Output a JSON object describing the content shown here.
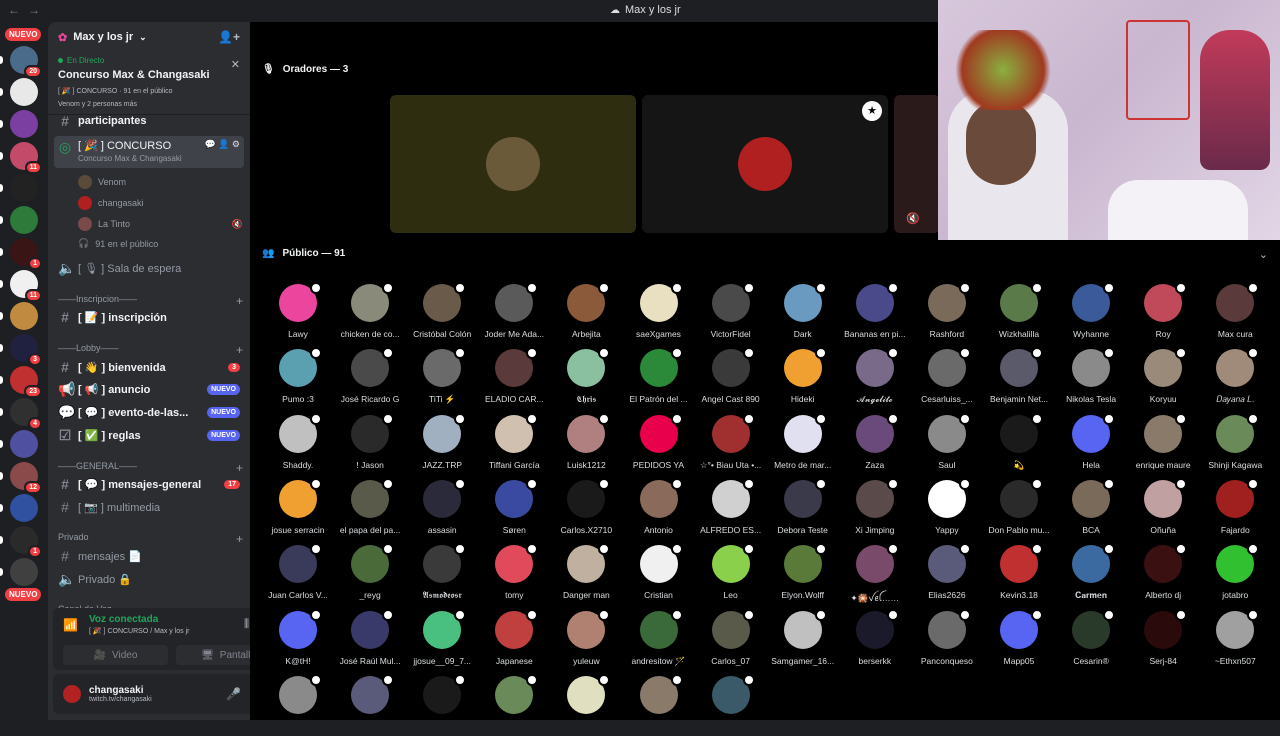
{
  "titlebar": {
    "title": "Max y los jr"
  },
  "server_rail": {
    "nuevo_top": "NUEVO",
    "nuevo_bottom": "NUEVO",
    "servers": [
      {
        "badge": "20",
        "color": "#4a6b8a"
      },
      {
        "badge": "",
        "color": "#e8e8e8"
      },
      {
        "badge": "",
        "color": "#7a3fa0"
      },
      {
        "badge": "11",
        "color": "#c44a6a"
      },
      {
        "badge": "",
        "color": "#222222"
      },
      {
        "badge": "",
        "color": "#2d7a3a"
      },
      {
        "badge": "1",
        "color": "#3a1515"
      },
      {
        "badge": "11",
        "color": "#f0f0f0"
      },
      {
        "badge": "",
        "color": "#c08a40"
      },
      {
        "badge": "3",
        "color": "#202040"
      },
      {
        "badge": "23",
        "color": "#c03030"
      },
      {
        "badge": "4",
        "color": "#303030"
      },
      {
        "badge": "",
        "color": "#5050a0"
      },
      {
        "badge": "12",
        "color": "#8a4a4a"
      },
      {
        "badge": "",
        "color": "#3050a0"
      },
      {
        "badge": "1",
        "color": "#2a2a2a"
      },
      {
        "badge": "",
        "color": "#404040"
      }
    ]
  },
  "server": {
    "name": "Max y los jr"
  },
  "event": {
    "live_label": "En Directo",
    "title": "Concurso Max & Changasaki",
    "meta": "[ 🎉 ] CONCURSO · 91 en el público",
    "attendees": "Venom y 2 personas más"
  },
  "channels": {
    "partial_top": "participantes",
    "concurso": {
      "name": "[ 🎉 ] CONCURSO",
      "sub": "Concurso Max & Changasaki"
    },
    "voice_users": [
      "Venom",
      "changasaki",
      "La Tinto"
    ],
    "audience": "91 en el público",
    "waiting": "[ 🎙 ] Sala de espera",
    "cat_inscripcion": "——Inscripcion——",
    "inscripcion": "[ 📝 ] inscripción",
    "cat_lobby": "——Lobby——",
    "bienvenida": "[ 👋 ] bienvenida",
    "bienvenida_count": "3",
    "anuncio": "[ 📢 ] anuncio",
    "evento": "[ 💬 ] evento-de-las...",
    "reglas": "[ ✅ ] reglas",
    "nuevo_tag": "NUEVO",
    "cat_general": "——GENERAL——",
    "mensajes_general": "[ 💬 ] mensajes-general",
    "mensajes_count": "17",
    "multimedia": "[ 📷 ] multimedia",
    "cat_privado": "Privado",
    "mensajes": "mensajes 📄",
    "privado": "Privado 🔒",
    "cat_canal": "Canal de Voz"
  },
  "voice_panel": {
    "status": "Voz conectada",
    "sub": "[ 🎉 ] CONCURSO / Max y los jr",
    "video": "Video",
    "screen": "Pantalla"
  },
  "user_panel": {
    "name": "changasaki",
    "status": "twitch.tv/changasaki"
  },
  "stage": {
    "speakers_header": "Oradores — 3",
    "public_header": "Público — 91"
  },
  "members": [
    [
      "Lawy",
      "#eb459e"
    ],
    [
      "chicken de co...",
      "#8a8a7a"
    ],
    [
      "Cristóbal Colón",
      "#6a5a4a"
    ],
    [
      "Joder Me Ada...",
      "#5a5a5a"
    ],
    [
      "Arbejita",
      "#8a5a3a"
    ],
    [
      "saeXgames",
      "#e8e0c0"
    ],
    [
      "VictorFidel",
      "#4a4a4a"
    ],
    [
      "Dark",
      "#6a9ac0"
    ],
    [
      "Bananas en pi...",
      "#4a4a8a"
    ],
    [
      "Rashford",
      "#7a6a5a"
    ],
    [
      "Wizkhalilla",
      "#5a7a4a"
    ],
    [
      "Wyhanne",
      "#3a5a9a"
    ],
    [
      "Roy",
      "#c04a5a"
    ],
    [
      "Max cura",
      "#5a3a3a"
    ],
    [
      "Pumo :3",
      "#5aa0b0"
    ],
    [
      "José Ricardo G",
      "#4a4a4a"
    ],
    [
      "TiTi ⚡",
      "#6a6a6a"
    ],
    [
      "ELADIO CAR...",
      "#5a3a3a"
    ],
    [
      "𝕮𝖍𝖗𝖎𝖘",
      "#8ac0a0"
    ],
    [
      "El Patrón del ...",
      "#2a8a3a"
    ],
    [
      "Angel Cast 890",
      "#3a3a3a"
    ],
    [
      "Hideki",
      "#f0a030"
    ],
    [
      "𝓐𝓷𝓰𝓮𝓵𝓲𝓽𝓸",
      "#7a6a8a"
    ],
    [
      "Cesarluiss_...",
      "#6a6a6a"
    ],
    [
      "Benjamin Net...",
      "#5a5a6a"
    ],
    [
      "Nikolas Tesla",
      "#8a8a8a"
    ],
    [
      "Koryuu",
      "#9a8a7a"
    ],
    [
      "𝐷𝑎𝑦𝑎𝑛𝑎 𝐿.",
      "#a08a7a"
    ],
    [
      "Shaddy.",
      "#c0c0c0"
    ],
    [
      "! Jason",
      "#2a2a2a"
    ],
    [
      "JAZZ.TRP",
      "#a0b0c0"
    ],
    [
      "Tiffani García",
      "#d0c0b0"
    ],
    [
      "Luisk1212",
      "#b08080"
    ],
    [
      "PEDIDOS YA",
      "#e8004c"
    ],
    [
      "☆°• Biau Uta •...",
      "#a03030"
    ],
    [
      "Metro de mar...",
      "#e0e0f0"
    ],
    [
      "Zaza",
      "#6a4a7a"
    ],
    [
      "Saul",
      "#8a8a8a"
    ],
    [
      "💫",
      "#1a1a1a"
    ],
    [
      "Hela",
      "#5865f2"
    ],
    [
      "enrique maure",
      "#8a7a6a"
    ],
    [
      "Shinji Kagawa",
      "#6a8a5a"
    ],
    [
      "josue serracin",
      "#f0a030"
    ],
    [
      "el papa del pa...",
      "#5a5a4a"
    ],
    [
      "assasin",
      "#2a2a3a"
    ],
    [
      "Søren",
      "#3a4aa0"
    ],
    [
      "Carlos.X2710",
      "#1a1a1a"
    ],
    [
      "Antonio",
      "#8a6a5a"
    ],
    [
      "ALFREDO ES...",
      "#d0d0d0"
    ],
    [
      "Debora Teste",
      "#3a3a4a"
    ],
    [
      "Xi Jimping",
      "#5a4a4a"
    ],
    [
      "Yappy",
      "#ffffff"
    ],
    [
      "Don Pablo mu...",
      "#2a2a2a"
    ],
    [
      "BCA",
      "#7a6a5a"
    ],
    [
      "Oñuña",
      "#c0a0a0"
    ],
    [
      "Fajardo",
      "#a02020"
    ],
    [
      "Juan Carlos V...",
      "#3a3a5a"
    ],
    [
      "_reyg",
      "#4a6a3a"
    ],
    [
      "𝕬𝖘𝖒𝖔𝖉𝖊𝖔𝖘𝖗",
      "#3a3a3a"
    ],
    [
      "tomy",
      "#e04a5a"
    ],
    [
      "Danger man",
      "#c0b0a0"
    ],
    [
      "Cristian",
      "#f0f0f0"
    ],
    [
      "Leo",
      "#8ad04a"
    ],
    [
      "Elyon.Wolff",
      "#5a7a3a"
    ],
    [
      "✦🎇ꪜꫀꪶ……",
      "#7a4a6a"
    ],
    [
      "Elias2626",
      "#5a5a7a"
    ],
    [
      "Kevin3.18",
      "#c03030"
    ],
    [
      "𝐂𝐚𝐫𝐦𝐞𝐧",
      "#3a6aa0"
    ],
    [
      "Alberto dj",
      "#3a1010"
    ],
    [
      "jotabro",
      "#30c030"
    ],
    [
      "K@tH!",
      "#5865f2"
    ],
    [
      "José Raúl Mul...",
      "#3a3a6a"
    ],
    [
      "jjosue__09_7...",
      "#4ac080"
    ],
    [
      "Japanese",
      "#c04040"
    ],
    [
      "yuleuw",
      "#b08070"
    ],
    [
      "andresitow 🪄",
      "#3a6a3a"
    ],
    [
      "Carlos_07",
      "#5a5a4a"
    ],
    [
      "Samgamer_16...",
      "#c0c0c0"
    ],
    [
      "berserkk",
      "#1a1a2a"
    ],
    [
      "Panconqueso",
      "#6a6a6a"
    ],
    [
      "Mapp05",
      "#5865f2"
    ],
    [
      "Cesarin®",
      "#2a3a2a"
    ],
    [
      "Serj-84",
      "#2a0a0a"
    ],
    [
      "~Ethxn507",
      "#a0a0a0"
    ],
    [
      "",
      "#8a8a8a"
    ],
    [
      "",
      "#5a5a7a"
    ],
    [
      "",
      "#1a1a1a"
    ],
    [
      "",
      "#6a8a5a"
    ],
    [
      "",
      "#e0e0c0"
    ],
    [
      "",
      "#8a7a6a"
    ],
    [
      "",
      "#3a5a6a"
    ]
  ],
  "speaker_tiles": [
    {
      "name": "Venom",
      "bg": "#2e2d10",
      "av": "#6a5a3a"
    },
    {
      "name": "changasaki",
      "bg": "#151515",
      "av": "#b02020"
    },
    {
      "name": "La Tinto",
      "bg": "#2a1a1a",
      "av": "#5a3a3a"
    }
  ]
}
